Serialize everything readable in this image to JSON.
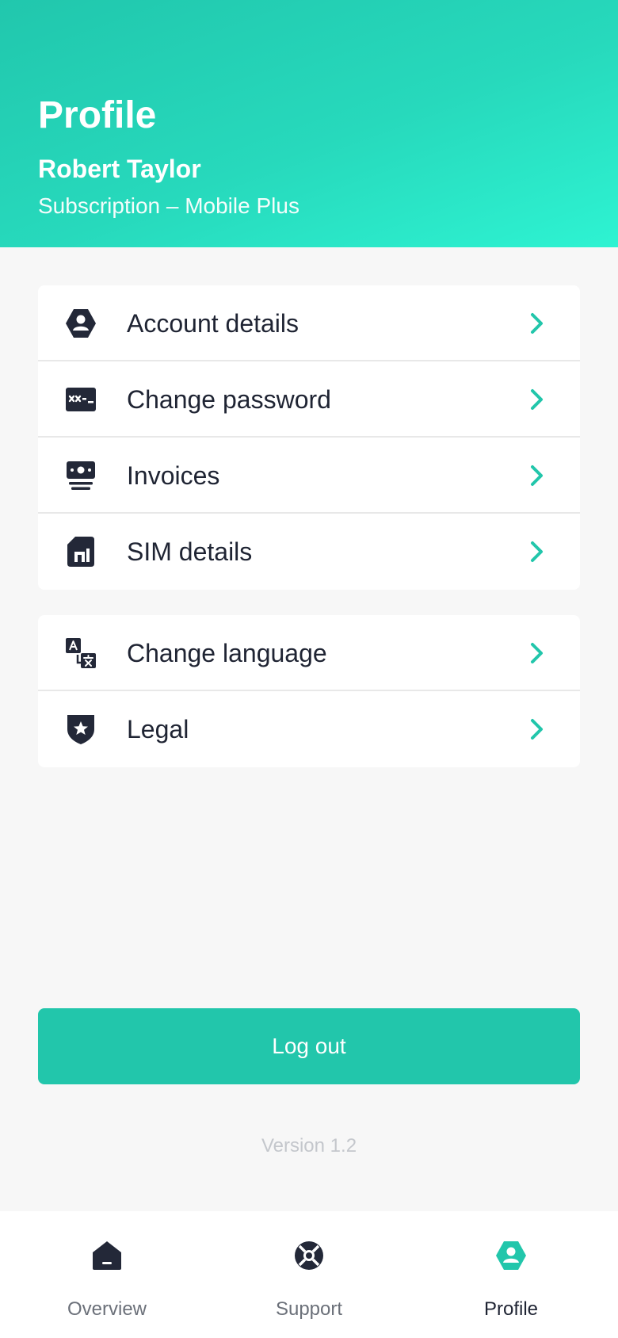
{
  "header": {
    "title": "Profile",
    "user_name": "Robert Taylor",
    "subscription": "Subscription – Mobile Plus"
  },
  "menu_group_1": [
    {
      "label": "Account details",
      "icon": "account-icon"
    },
    {
      "label": "Change password",
      "icon": "password-icon"
    },
    {
      "label": "Invoices",
      "icon": "invoice-icon"
    },
    {
      "label": "SIM details",
      "icon": "sim-card-icon"
    }
  ],
  "menu_group_2": [
    {
      "label": "Change language",
      "icon": "translate-icon"
    },
    {
      "label": "Legal",
      "icon": "shield-star-icon"
    }
  ],
  "logout_label": "Log out",
  "version": "Version 1.2",
  "tabs": [
    {
      "label": "Overview",
      "icon": "home-icon",
      "active": false
    },
    {
      "label": "Support",
      "icon": "lifebuoy-icon",
      "active": false
    },
    {
      "label": "Profile",
      "icon": "profile-icon",
      "active": true
    }
  ],
  "colors": {
    "accent": "#22c6ab",
    "icon_dark": "#232838",
    "background": "#f7f7f7"
  }
}
